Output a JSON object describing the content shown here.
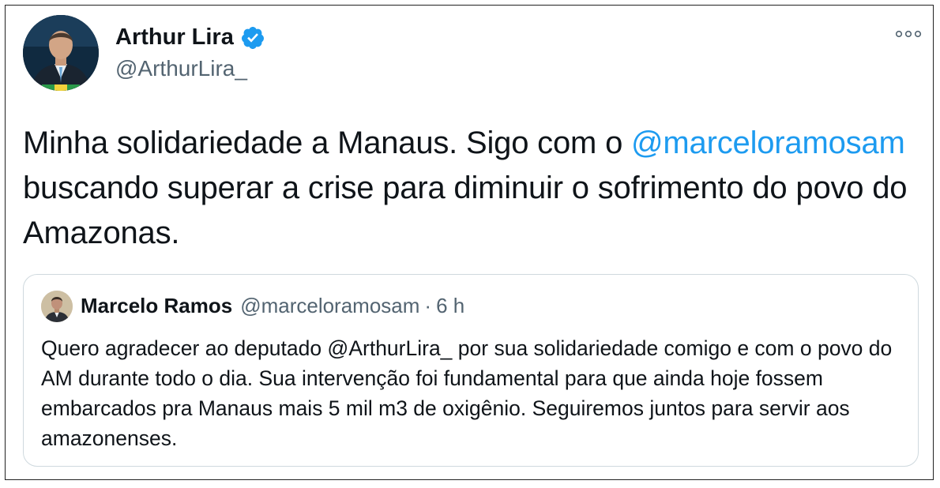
{
  "tweet": {
    "author": {
      "display_name": "Arthur Lira",
      "handle": "@ArthurLira_",
      "verified_icon": "verified-badge-icon"
    },
    "text_before_mention": "Minha solidariedade a Manaus. Sigo com o ",
    "mention": "@marceloramosam",
    "text_after_mention": " buscando superar a crise para diminuir o sofrimento do povo do Amazonas.",
    "more_icon": "more-options-icon"
  },
  "quote": {
    "author": {
      "display_name": "Marcelo Ramos",
      "handle": "@marceloramosam",
      "separator": "·",
      "time": "6 h"
    },
    "text": "Quero agradecer ao deputado @ArthurLira_ por sua solidariedade comigo e com o povo do AM durante todo o dia. Sua intervenção foi fundamental para que ainda hoje fossem embarcados pra Manaus mais 5 mil m3 de oxigênio. Seguiremos juntos para servir aos amazonenses."
  },
  "colors": {
    "link": "#1d9bf0",
    "secondary_text": "#536471",
    "border": "#cfd9de",
    "verified": "#1d9bf0"
  }
}
